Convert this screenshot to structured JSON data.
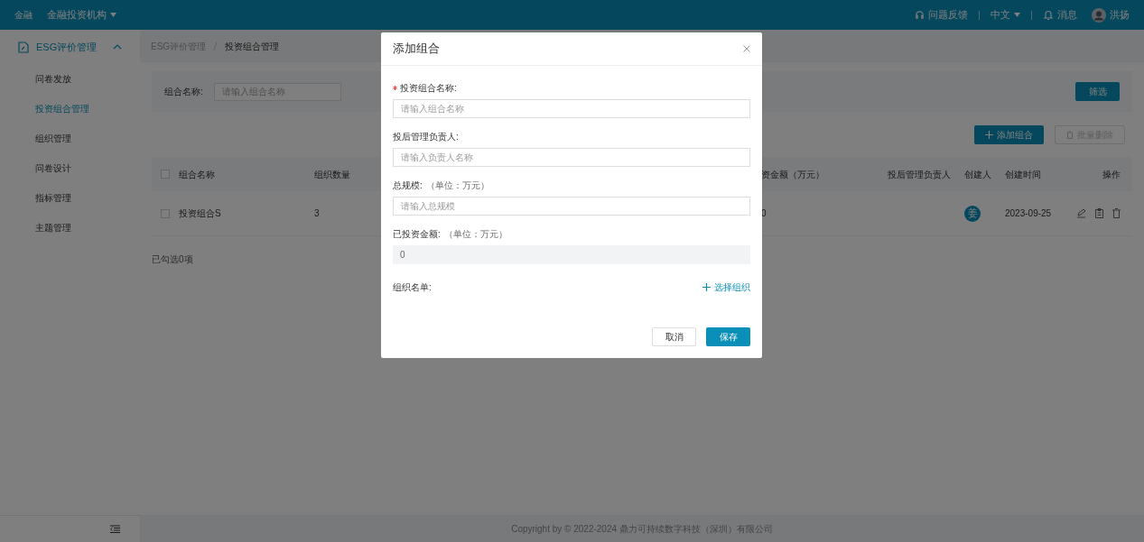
{
  "header": {
    "org_label": "金融",
    "org": "金融投资机构",
    "feedback": "问题反馈",
    "language": "中文",
    "messages": "消息",
    "user": "洪扬"
  },
  "sidebar": {
    "group": {
      "label": "ESG评价管理",
      "expanded": true
    },
    "items": [
      {
        "label": "问卷发放",
        "selected": false
      },
      {
        "label": "投资组合管理",
        "selected": true
      },
      {
        "label": "组织管理",
        "selected": false
      },
      {
        "label": "问卷设计",
        "selected": false
      },
      {
        "label": "指标管理",
        "selected": false
      },
      {
        "label": "主题管理",
        "selected": false
      }
    ]
  },
  "breadcrumb": [
    "ESG评价管理",
    "投资组合管理"
  ],
  "filter": {
    "label": "组合名称:",
    "placeholder": "请输入组合名称",
    "button": "筛选"
  },
  "toolbar": {
    "add": "添加组合",
    "delete": {
      "label": "批量删除",
      "disabled": true
    }
  },
  "table": {
    "all_checked": false,
    "columns": [
      "组合名称",
      "组织数量",
      "资金额（万元）",
      "投后管理负责人",
      "创建人",
      "创建时间",
      "操作"
    ],
    "rows": [
      {
        "checked": false,
        "name": "投资组合S",
        "count": "3",
        "amount": "0",
        "manager": "",
        "creator": "姜",
        "created": "2023-09-25"
      }
    ]
  },
  "selection_count": "已勾选0项",
  "footer": "Copyright by © 2022-2024 鼎力可持续数字科技（深圳）有限公司",
  "dialog": {
    "title": "添加组合",
    "fields": [
      {
        "kind": "input",
        "label": "投资组合名称:",
        "required": true,
        "placeholder": "请输入组合名称"
      },
      {
        "kind": "input",
        "label": "投后管理负责人:",
        "required": false,
        "placeholder": "请输入负责人名称"
      },
      {
        "kind": "input",
        "label": "总规模:",
        "hint": "（单位：万元）",
        "required": false,
        "placeholder": "请输入总规模"
      },
      {
        "kind": "readonly",
        "label": "已投资金额:",
        "hint": "（单位：万元）",
        "required": false,
        "value": "0"
      },
      {
        "kind": "picker",
        "label": "组织名单:",
        "required": false,
        "action": "选择组织"
      }
    ],
    "buttons": {
      "cancel": "取消",
      "save": "保存"
    }
  }
}
